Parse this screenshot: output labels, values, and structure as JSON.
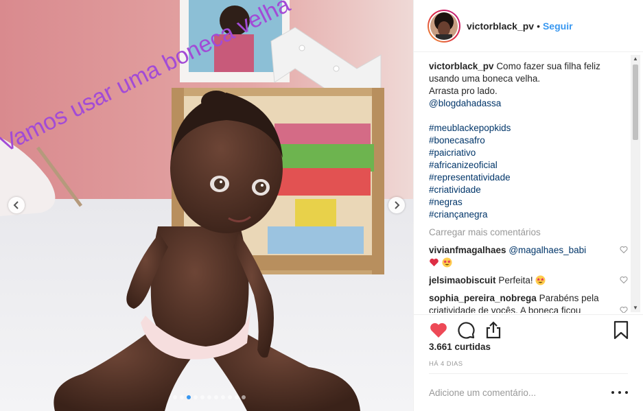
{
  "media": {
    "overlay_text": "Vamos usar uma boneca velha",
    "slide_count": 11,
    "active_slide": 2,
    "accent_color": "#3897f0"
  },
  "header": {
    "username": "victorblack_pv",
    "separator": "•",
    "follow_label": "Seguir"
  },
  "caption": {
    "username": "victorblack_pv",
    "lines": [
      "Como fazer sua filha feliz",
      "usando uma boneca velha.",
      "Arrasta pro lado."
    ],
    "mention": "@blogdahadassa",
    "hashtags": [
      "#meublackepopkids",
      "#bonecasafro",
      "#paicriativo",
      "#africanizeoficial",
      "#representatividade",
      "#criatividade",
      "#negras",
      "#criançanegra"
    ]
  },
  "load_more_label": "Carregar mais comentários",
  "comments": [
    {
      "username": "vivianfmagalhaes",
      "text": "@magalhaes_babi",
      "emojis": [
        "red-heart",
        "star-struck"
      ]
    },
    {
      "username": "jelsimaobiscuit",
      "text": "Perfeita!",
      "emojis": [
        "star-struck"
      ]
    },
    {
      "username": "sophia_pereira_nobrega",
      "text": "Parabéns pela criatividade de vocês. A boneca ficou",
      "emojis": []
    }
  ],
  "actions": {
    "like_icon": "heart-icon",
    "comment_icon": "comment-icon",
    "share_icon": "share-icon",
    "save_icon": "bookmark-icon",
    "like_color": "#ed4956"
  },
  "likes_label": "3.661 curtidas",
  "time_label": "HÁ 4 DIAS",
  "add_comment_placeholder": "Adicione um comentário..."
}
